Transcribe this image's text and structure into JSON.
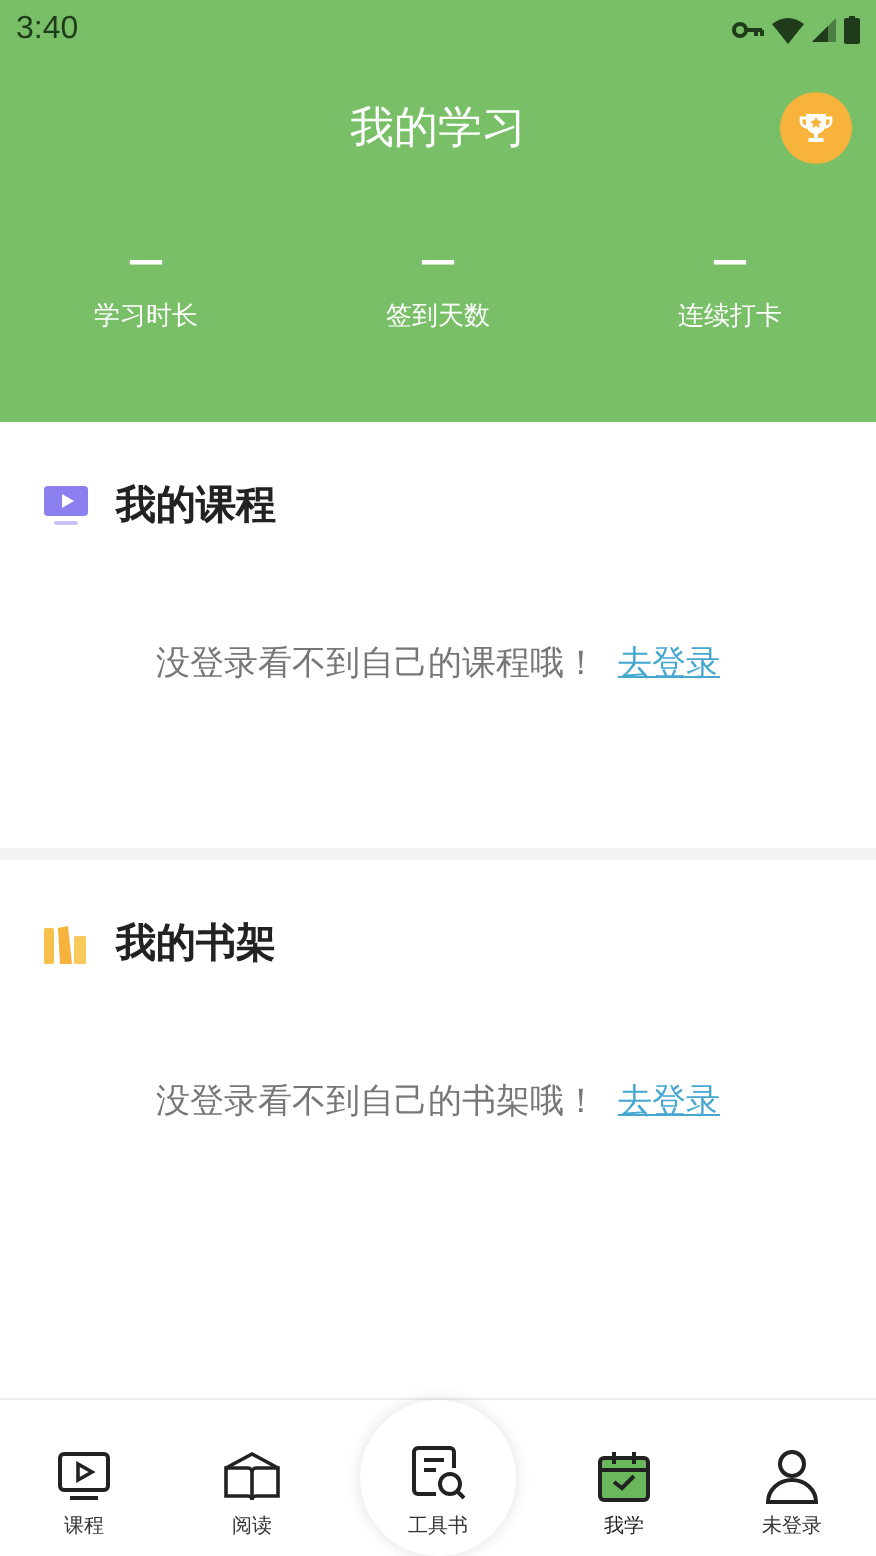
{
  "status_bar": {
    "time": "3:40"
  },
  "header": {
    "title": "我的学习"
  },
  "stats": [
    {
      "value": "—",
      "label": "学习时长"
    },
    {
      "value": "—",
      "label": "签到天数"
    },
    {
      "value": "—",
      "label": "连续打卡"
    }
  ],
  "sections": [
    {
      "kind": "course",
      "title": "我的课程",
      "message": "没登录看不到自己的课程哦！",
      "link": "去登录"
    },
    {
      "kind": "shelf",
      "title": "我的书架",
      "message": "没登录看不到自己的书架哦！",
      "link": "去登录"
    }
  ],
  "tabs": [
    {
      "kind": "course",
      "label": "课程",
      "selected": false
    },
    {
      "kind": "read",
      "label": "阅读",
      "selected": false
    },
    {
      "kind": "tool",
      "label": "工具书",
      "selected": false
    },
    {
      "kind": "study",
      "label": "我学",
      "selected": true
    },
    {
      "kind": "user",
      "label": "未登录",
      "selected": false
    }
  ]
}
